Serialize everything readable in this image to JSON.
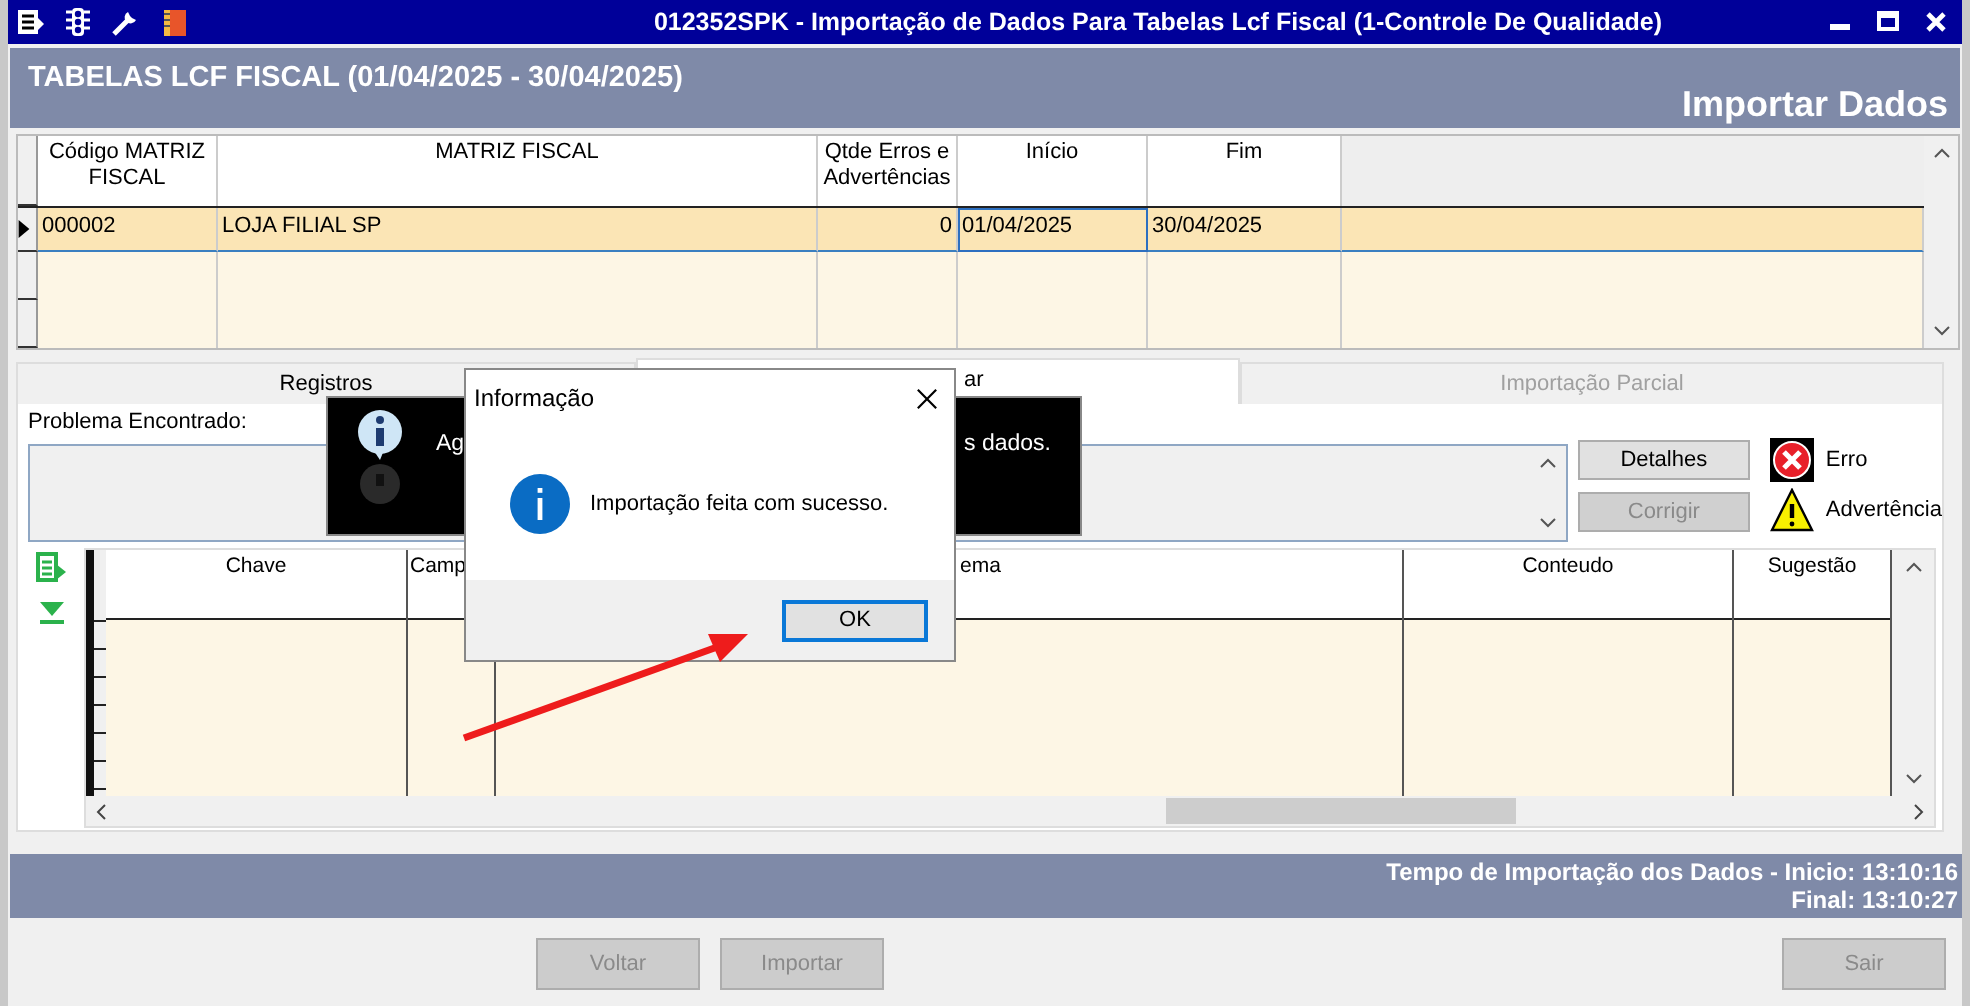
{
  "window": {
    "title": "012352SPK - Importação de Dados Para Tabelas Lcf Fiscal (1-Controle De Qualidade)"
  },
  "header": {
    "title": "TABELAS LCF FISCAL (01/04/2025 - 30/04/2025)",
    "action": "Importar Dados"
  },
  "matrix_table": {
    "columns": [
      "Código MATRIZ FISCAL",
      "MATRIZ FISCAL",
      "Qtde Erros e Advertências",
      "Início",
      "Fim"
    ],
    "rows": [
      {
        "cells": [
          "000002",
          "LOJA FILIAL SP",
          "0",
          "01/04/2025",
          "30/04/2025"
        ],
        "selected": true
      }
    ]
  },
  "tabs": [
    {
      "label": "Registros",
      "selected": false,
      "disabled": false
    },
    {
      "label": "ar",
      "selected": true,
      "disabled": false
    },
    {
      "label": "Importação Parcial",
      "selected": false,
      "disabled": true
    }
  ],
  "problem": {
    "label": "Problema Encontrado:"
  },
  "side_buttons": [
    {
      "label": "Detalhes",
      "disabled": false
    },
    {
      "label": "Corrigir",
      "disabled": true
    }
  ],
  "legend": [
    {
      "kind": "error",
      "label": "Erro"
    },
    {
      "kind": "warning",
      "label": "Advertência"
    }
  ],
  "records_table": {
    "columns": [
      "Chave",
      "Camp",
      "ema",
      "Conteudo",
      "Sugestão"
    ]
  },
  "status": {
    "lines": [
      "Tempo de Importação dos Dados - Inicio: 13:10:16",
      "Final: 13:10:27"
    ]
  },
  "buttons": [
    {
      "label": "Voltar",
      "disabled": true
    },
    {
      "label": "Importar",
      "disabled": true
    },
    {
      "label": "Sair",
      "disabled": true
    }
  ],
  "toast": {
    "text_start": "Ag",
    "text_end": "s dados."
  },
  "dialog": {
    "title": "Informação",
    "message": "Importação feita com sucesso.",
    "button": "OK"
  }
}
